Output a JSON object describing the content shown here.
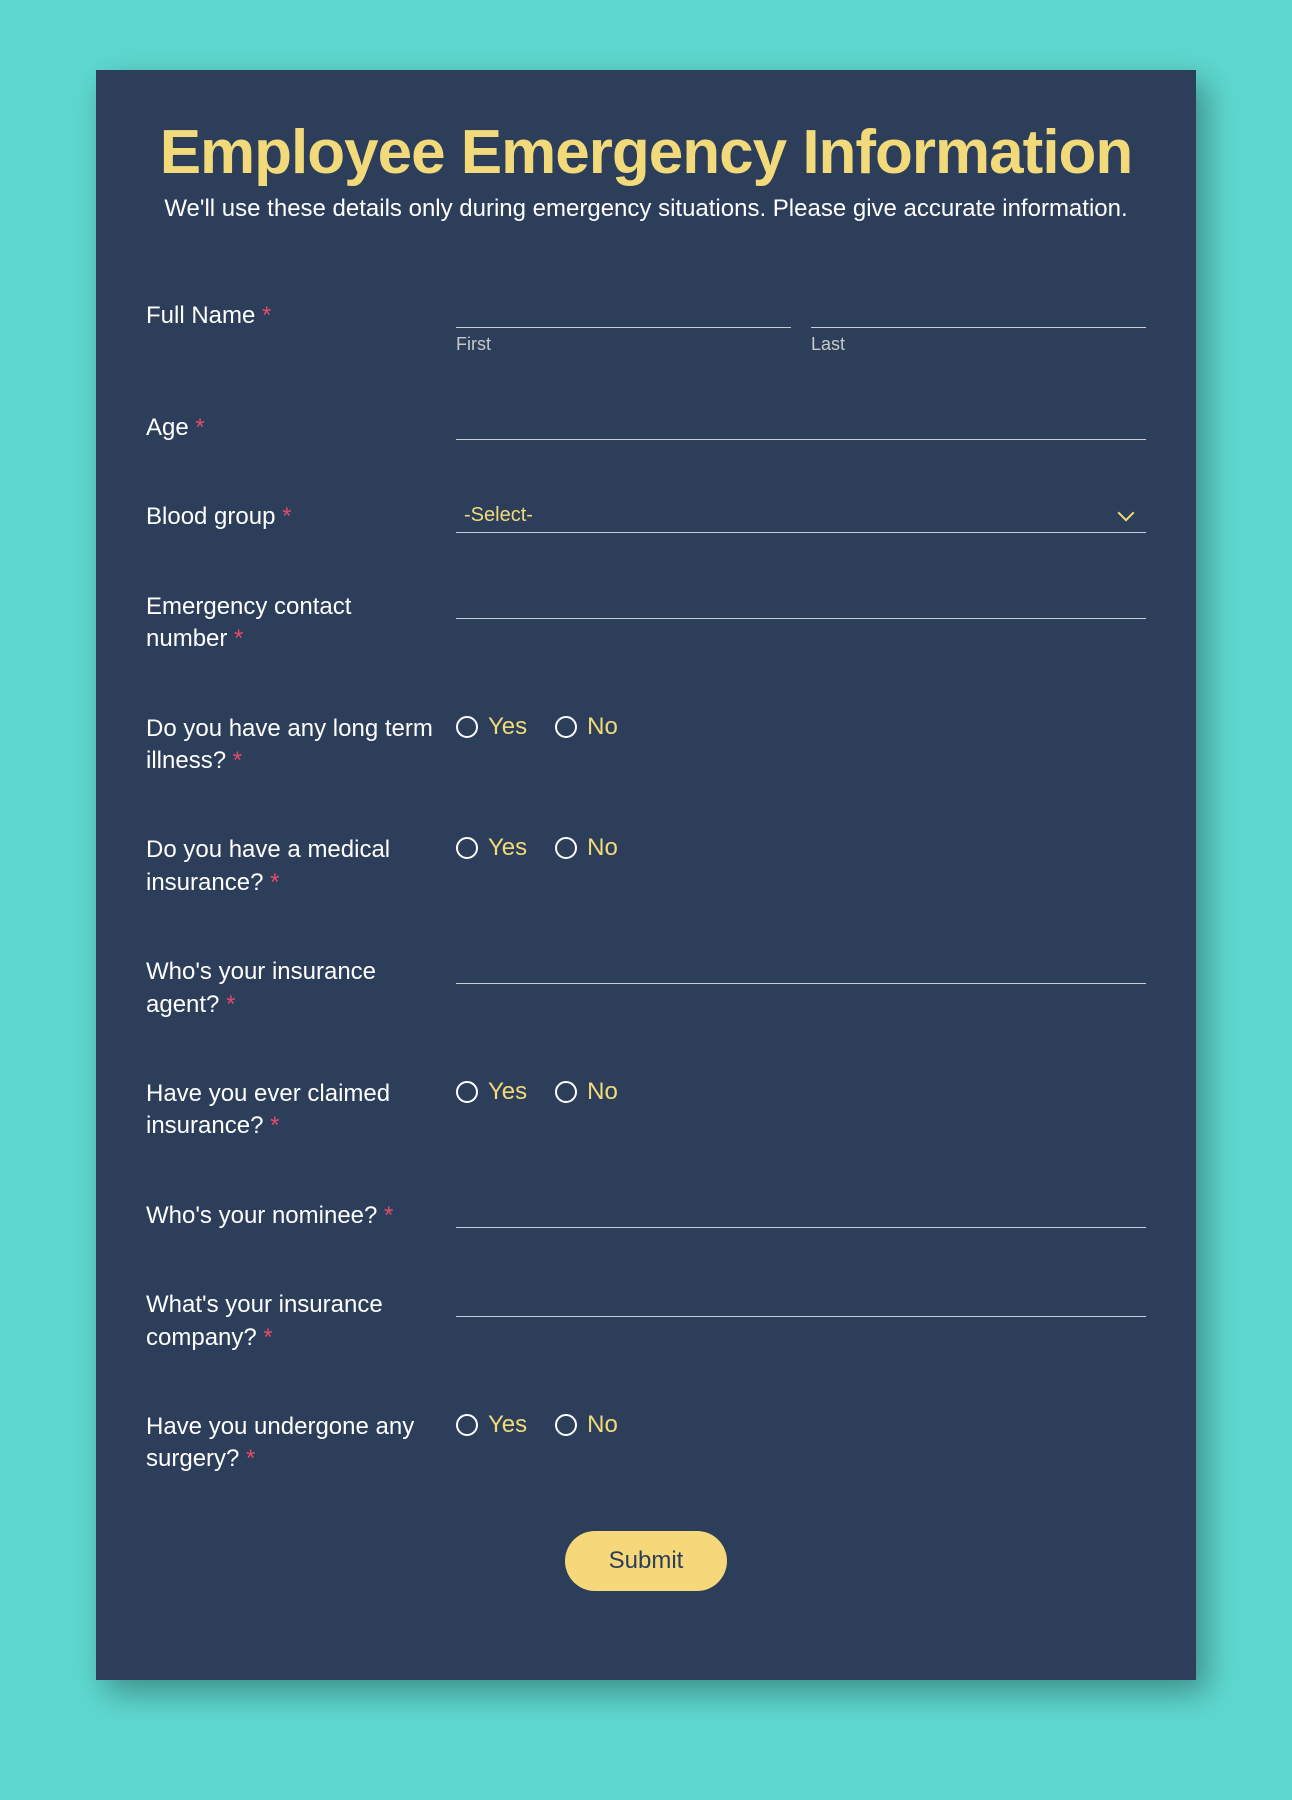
{
  "header": {
    "title": "Employee Emergency Information",
    "subtitle": "We'll use these details only during emergency situations. Please give accurate information."
  },
  "common": {
    "required_mark": "*",
    "yes": "Yes",
    "no": "No"
  },
  "fields": {
    "full_name": {
      "label": "Full Name",
      "first_sub": "First",
      "last_sub": "Last",
      "first_val": "",
      "last_val": ""
    },
    "age": {
      "label": "Age",
      "value": ""
    },
    "blood_group": {
      "label": "Blood group",
      "placeholder": "-Select-"
    },
    "emergency_contact": {
      "label": "Emergency contact number",
      "value": ""
    },
    "long_term_illness": {
      "label": "Do you have any long term illness?"
    },
    "medical_insurance": {
      "label": "Do you have a medical insurance?"
    },
    "insurance_agent": {
      "label": "Who's your insurance agent?",
      "value": ""
    },
    "claimed_insurance": {
      "label": "Have you ever claimed insurance?"
    },
    "nominee": {
      "label": "Who's your nominee?",
      "value": ""
    },
    "insurance_company": {
      "label": "What's your insurance company?",
      "value": ""
    },
    "surgery": {
      "label": "Have you undergone any surgery?"
    }
  },
  "footer": {
    "submit": "Submit"
  }
}
